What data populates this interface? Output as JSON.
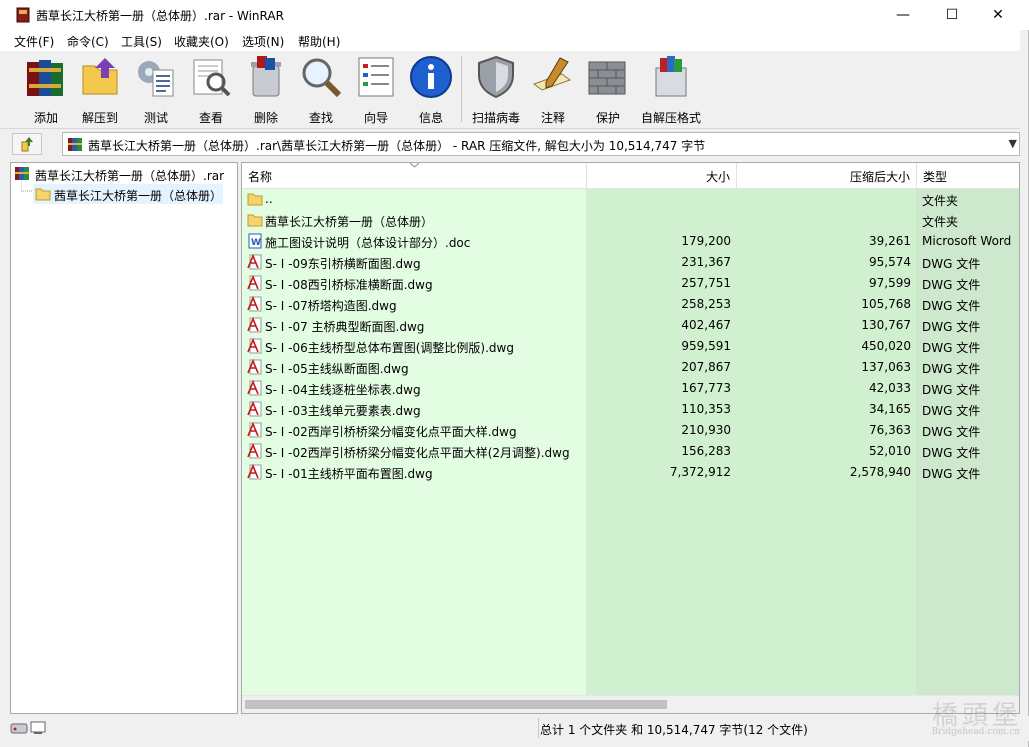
{
  "window": {
    "title": "茜草长江大桥第一册（总体册）.rar - WinRAR",
    "minimize": "—",
    "maximize": "☐",
    "close": "✕"
  },
  "menu": [
    "文件(F)",
    "命令(C)",
    "工具(S)",
    "收藏夹(O)",
    "选项(N)",
    "帮助(H)"
  ],
  "toolbar": [
    {
      "label": "添加",
      "icon": "books-add-icon"
    },
    {
      "label": "解压到",
      "icon": "folder-extract-icon"
    },
    {
      "label": "测试",
      "icon": "test-checklist-icon"
    },
    {
      "label": "查看",
      "icon": "view-book-icon"
    },
    {
      "label": "删除",
      "icon": "delete-bin-icon"
    },
    {
      "label": "查找",
      "icon": "magnifier-icon"
    },
    {
      "label": "向导",
      "icon": "wizard-list-icon"
    },
    {
      "label": "信息",
      "icon": "info-icon"
    },
    {
      "label": "扫描病毒",
      "icon": "shield-scan-icon"
    },
    {
      "label": "注释",
      "icon": "comment-pen-icon"
    },
    {
      "label": "保护",
      "icon": "brick-wall-icon"
    },
    {
      "label": "自解压格式",
      "icon": "sfx-box-icon"
    }
  ],
  "address": {
    "path": "茜草长江大桥第一册（总体册）.rar\\茜草长江大桥第一册（总体册） - RAR 压缩文件, 解包大小为 10,514,747 字节"
  },
  "tree": {
    "root": "茜草长江大桥第一册（总体册）.rar",
    "child": "茜草长江大桥第一册（总体册）"
  },
  "columns": {
    "name": "名称",
    "size": "大小",
    "packed": "压缩后大小",
    "type": "类型"
  },
  "files": [
    {
      "name": "..",
      "size": "",
      "packed": "",
      "type": "文件夹",
      "icon": "folder"
    },
    {
      "name": "茜草长江大桥第一册（总体册）",
      "size": "",
      "packed": "",
      "type": "文件夹",
      "icon": "folder"
    },
    {
      "name": "施工图设计说明（总体设计部分）.doc",
      "size": "179,200",
      "packed": "39,261",
      "type": "Microsoft Word",
      "icon": "word"
    },
    {
      "name": "S- I -09东引桥横断面图.dwg",
      "size": "231,367",
      "packed": "95,574",
      "type": "DWG 文件",
      "icon": "dwg"
    },
    {
      "name": "S- I -08西引桥标准横断面.dwg",
      "size": "257,751",
      "packed": "97,599",
      "type": "DWG 文件",
      "icon": "dwg"
    },
    {
      "name": "S- I -07桥塔构造图.dwg",
      "size": "258,253",
      "packed": "105,768",
      "type": "DWG 文件",
      "icon": "dwg"
    },
    {
      "name": "S- I -07 主桥典型断面图.dwg",
      "size": "402,467",
      "packed": "130,767",
      "type": "DWG 文件",
      "icon": "dwg"
    },
    {
      "name": "S- I -06主线桥型总体布置图(调整比例版).dwg",
      "size": "959,591",
      "packed": "450,020",
      "type": "DWG 文件",
      "icon": "dwg"
    },
    {
      "name": "S- I -05主线纵断面图.dwg",
      "size": "207,867",
      "packed": "137,063",
      "type": "DWG 文件",
      "icon": "dwg"
    },
    {
      "name": "S- I -04主线逐桩坐标表.dwg",
      "size": "167,773",
      "packed": "42,033",
      "type": "DWG 文件",
      "icon": "dwg"
    },
    {
      "name": "S- I -03主线单元要素表.dwg",
      "size": "110,353",
      "packed": "34,165",
      "type": "DWG 文件",
      "icon": "dwg"
    },
    {
      "name": "S- I -02西岸引桥桥梁分幅变化点平面大样.dwg",
      "size": "210,930",
      "packed": "76,363",
      "type": "DWG 文件",
      "icon": "dwg"
    },
    {
      "name": "S- I -02西岸引桥桥梁分幅变化点平面大样(2月调整).dwg",
      "size": "156,283",
      "packed": "52,010",
      "type": "DWG 文件",
      "icon": "dwg"
    },
    {
      "name": "S- I -01主线桥平面布置图.dwg",
      "size": "7,372,912",
      "packed": "2,578,940",
      "type": "DWG 文件",
      "icon": "dwg"
    }
  ],
  "status": {
    "summary": "总计 1 个文件夹 和 10,514,747 字节(12 个文件)"
  },
  "watermark": {
    "main": "橋頭堡",
    "sub": "Bridgehead.com.cn"
  },
  "colors": {
    "name_col_bg": "#e3fde3",
    "size_col_bg": "#d0f0d0",
    "type_col_bg": "#cde8cd"
  }
}
